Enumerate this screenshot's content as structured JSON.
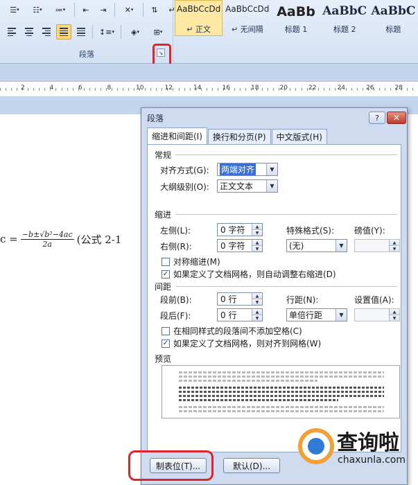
{
  "ribbon": {
    "group_label": "段落",
    "styles": [
      {
        "sample": "AaBbCcDd",
        "name": "↵ 正文",
        "selected": true
      },
      {
        "sample": "AaBbCcDd",
        "name": "↵ 无间隔",
        "selected": false
      },
      {
        "sample": "AaBb",
        "name": "标题 1",
        "selected": false
      },
      {
        "sample": "AaBbC",
        "name": "标题 2",
        "selected": false
      },
      {
        "sample": "AaBbC",
        "name": "标题",
        "selected": false
      }
    ]
  },
  "ruler": {
    "labels": [
      "2",
      "4",
      "6",
      "8",
      "10",
      "12",
      "14",
      "16",
      "18",
      "20",
      "22",
      "24",
      "26",
      "28"
    ]
  },
  "document": {
    "formula_lhs": "c =",
    "numerator": "−b±√b²−4ac",
    "denominator": "2a",
    "caption": "(公式 2-1"
  },
  "dialog": {
    "title": "段落",
    "help_label": "?",
    "close_label": "✕",
    "tabs": [
      "缩进和间距(I)",
      "换行和分页(P)",
      "中文版式(H)"
    ],
    "general": {
      "section": "常规",
      "alignment_label": "对齐方式(G):",
      "alignment_value": "两端对齐",
      "outline_label": "大纲级别(O):",
      "outline_value": "正文文本"
    },
    "indent": {
      "section": "缩进",
      "left_label": "左侧(L):",
      "left_value": "0 字符",
      "right_label": "右侧(R):",
      "right_value": "0 字符",
      "special_label": "特殊格式(S):",
      "special_value": "(无)",
      "by_label": "磅值(Y):",
      "by_value": "",
      "mirror_label": "对称缩进(M)",
      "mirror_checked": false,
      "auto_right_label": "如果定义了文档网格，则自动调整右缩进(D)",
      "auto_right_checked": true
    },
    "spacing": {
      "section": "间距",
      "before_label": "段前(B):",
      "before_value": "0 行",
      "after_label": "段后(F):",
      "after_value": "0 行",
      "line_label": "行距(N):",
      "line_value": "单倍行距",
      "at_label": "设置值(A):",
      "at_value": "",
      "no_space_label": "在相同样式的段落间不添加空格(C)",
      "no_space_checked": false,
      "snap_label": "如果定义了文档网格，则对齐到网格(W)",
      "snap_checked": true
    },
    "preview": {
      "section": "预览"
    },
    "buttons": {
      "tabs": "制表位(T)...",
      "default": "默认(D)..."
    }
  },
  "watermark": {
    "brand": "查询啦",
    "url": "chaxunla.com"
  },
  "colors": {
    "accent_red": "#e0232c",
    "ribbon_bg": "#d3e1f3",
    "dialog_bg": "#cfdcef",
    "selection": "#3b6fd8"
  }
}
